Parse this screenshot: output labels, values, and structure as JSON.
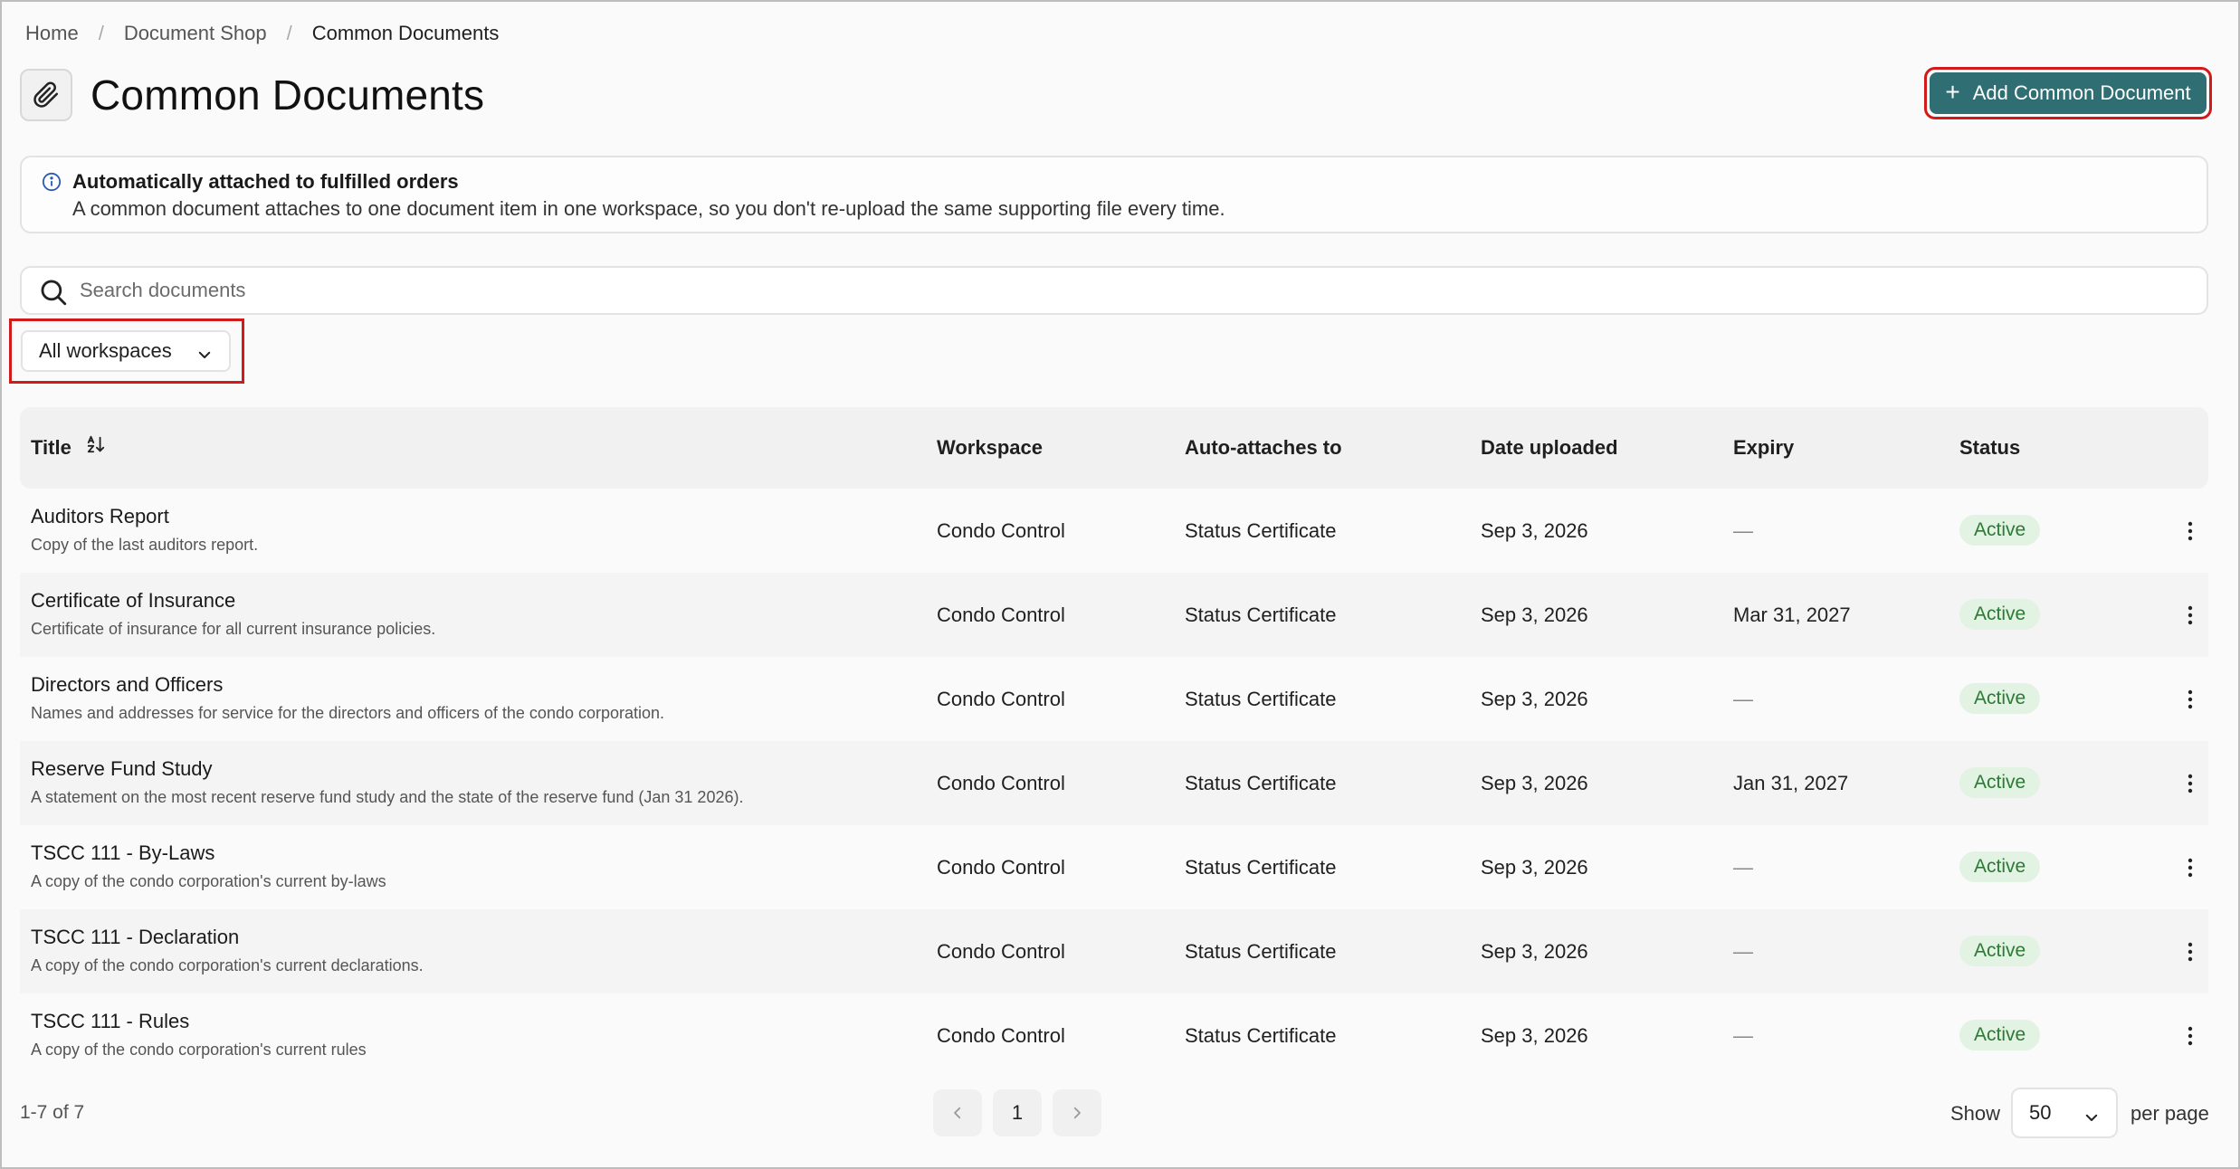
{
  "breadcrumb": {
    "home": "Home",
    "shop": "Document Shop",
    "current": "Common Documents"
  },
  "header": {
    "title": "Common Documents",
    "add_label": "Add Common Document"
  },
  "info": {
    "title": "Automatically attached to fulfilled orders",
    "text": "A common document attaches to one document item in one workspace, so you don't re-upload the same supporting file every time."
  },
  "search": {
    "placeholder": "Search documents"
  },
  "filter": {
    "workspace": "All workspaces"
  },
  "table": {
    "headers": {
      "title": "Title",
      "workspace": "Workspace",
      "auto": "Auto-attaches to",
      "date": "Date uploaded",
      "expiry": "Expiry",
      "status": "Status"
    },
    "rows": [
      {
        "title": "Auditors Report",
        "desc": "Copy of the last auditors report.",
        "workspace": "Condo Control",
        "auto": "Status Certificate",
        "date": "Sep 3, 2026",
        "expiry": "—",
        "status": "Active"
      },
      {
        "title": "Certificate of Insurance",
        "desc": "Certificate of insurance for all current insurance policies.",
        "workspace": "Condo Control",
        "auto": "Status Certificate",
        "date": "Sep 3, 2026",
        "expiry": "Mar 31, 2027",
        "status": "Active"
      },
      {
        "title": "Directors and Officers",
        "desc": "Names and addresses for service for the directors and officers of the condo corporation.",
        "workspace": "Condo Control",
        "auto": "Status Certificate",
        "date": "Sep 3, 2026",
        "expiry": "—",
        "status": "Active"
      },
      {
        "title": "Reserve Fund Study",
        "desc": "A statement on the most recent reserve fund study and the state of the reserve fund (Jan 31 2026).",
        "workspace": "Condo Control",
        "auto": "Status Certificate",
        "date": "Sep 3, 2026",
        "expiry": "Jan 31, 2027",
        "status": "Active"
      },
      {
        "title": "TSCC 111 - By-Laws",
        "desc": "A copy of the condo corporation's current by-laws",
        "workspace": "Condo Control",
        "auto": "Status Certificate",
        "date": "Sep 3, 2026",
        "expiry": "—",
        "status": "Active"
      },
      {
        "title": "TSCC 111 - Declaration",
        "desc": "A copy of the condo corporation's current declarations.",
        "workspace": "Condo Control",
        "auto": "Status Certificate",
        "date": "Sep 3, 2026",
        "expiry": "—",
        "status": "Active"
      },
      {
        "title": "TSCC 111 - Rules",
        "desc": "A copy of the condo corporation's current rules",
        "workspace": "Condo Control",
        "auto": "Status Certificate",
        "date": "Sep 3, 2026",
        "expiry": "—",
        "status": "Active"
      }
    ]
  },
  "pagination": {
    "count": "1-7 of 7",
    "page": "1",
    "show_label": "Show",
    "per_page": "50",
    "per_page_label": "per page"
  },
  "colors": {
    "accent": "#2f6f73",
    "highlight": "#d21a1a",
    "active_bg": "#e2f2e3",
    "active_text": "#2c7a34"
  }
}
